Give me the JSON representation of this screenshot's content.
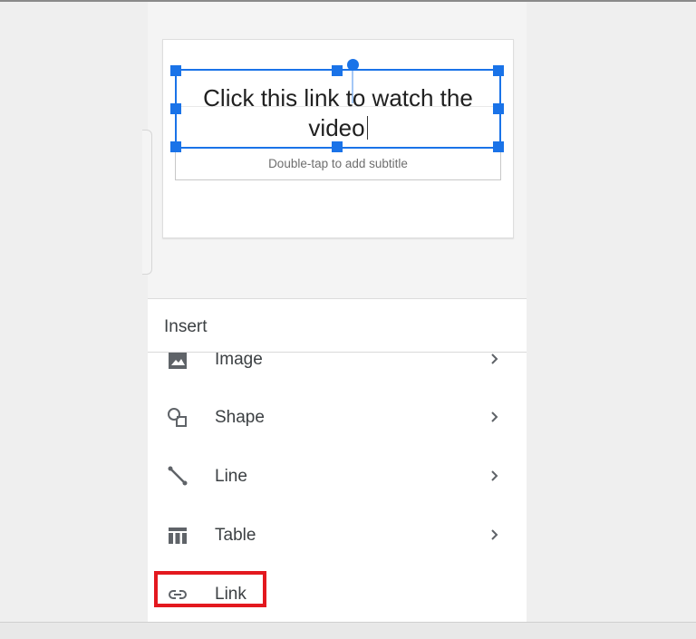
{
  "slide": {
    "title": "Click this link to watch the video",
    "subtitle_placeholder": "Double-tap to add subtitle"
  },
  "insert_sheet": {
    "title": "Insert",
    "items": [
      {
        "label": "Image",
        "icon": "image-icon",
        "has_submenu": true
      },
      {
        "label": "Shape",
        "icon": "shape-icon",
        "has_submenu": true
      },
      {
        "label": "Line",
        "icon": "line-icon",
        "has_submenu": true
      },
      {
        "label": "Table",
        "icon": "table-icon",
        "has_submenu": true
      },
      {
        "label": "Link",
        "icon": "link-icon",
        "has_submenu": false
      }
    ]
  },
  "colors": {
    "selection": "#1a73e8",
    "highlight": "#e3181f",
    "text": "#3c4043"
  }
}
